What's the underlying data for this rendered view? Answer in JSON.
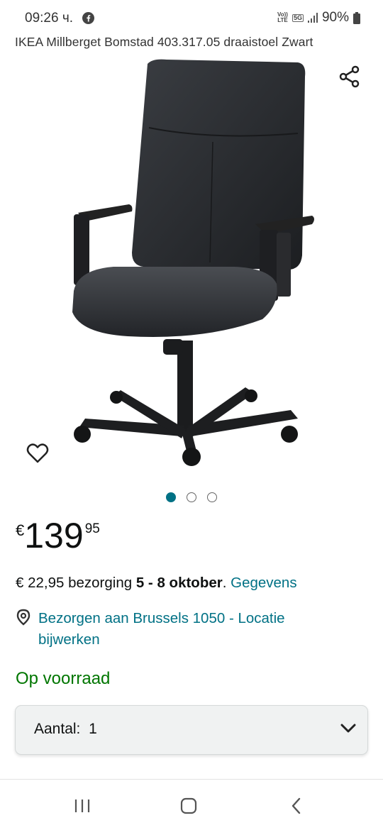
{
  "status_bar": {
    "time": "09:26 ч.",
    "volte_label_top": "Vo))",
    "volte_label_bottom": "LTE",
    "network_label": "5G",
    "battery_percent": "90%",
    "icons": [
      "facebook-icon",
      "volte-icon",
      "5g-icon",
      "signal-icon",
      "battery-icon"
    ]
  },
  "product": {
    "title": "IKEA Millberget Bomstad 403.317.05 draaistoel Zwart",
    "image_name": "office-chair-image",
    "gallery_page_count": 3,
    "gallery_active_index": 0
  },
  "actions": {
    "share_icon": "share-icon",
    "wishlist_icon": "heart-icon"
  },
  "price": {
    "currency": "€",
    "whole": "139",
    "fraction": "95"
  },
  "delivery": {
    "prefix": "€ 22,95 bezorging ",
    "dates": "5 - 8 oktober",
    "suffix": ". ",
    "details_link": "Gegevens"
  },
  "location": {
    "icon": "location-pin-icon",
    "text": "Bezorgen aan Brussels 1050 - Locatie bijwerken"
  },
  "availability": "Op voorraad",
  "quantity": {
    "label": "Aantal:",
    "value": "1",
    "icon": "chevron-down-icon"
  },
  "nav_bar": {
    "buttons": [
      "recent-apps-icon",
      "home-icon",
      "back-icon"
    ]
  },
  "colors": {
    "link": "#007185",
    "in_stock": "#007600",
    "text": "#0f1111",
    "active_dot": "#007185"
  }
}
